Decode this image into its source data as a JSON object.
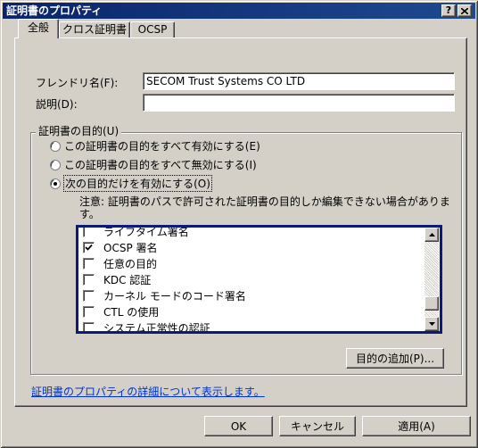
{
  "window": {
    "title": "証明書のプロパティ",
    "help_button": "?",
    "close_icon": "close-icon"
  },
  "tabs": [
    {
      "label": "全般",
      "selected": true
    },
    {
      "label": "クロス証明書",
      "selected": false
    },
    {
      "label": "OCSP",
      "selected": false
    }
  ],
  "general": {
    "friendly_name_label": "フレンドリ名(F):",
    "friendly_name_value": "SECOM Trust Systems CO LTD",
    "description_label": "説明(D):",
    "description_value": "",
    "purposes": {
      "group_label": "証明書の目的(U)",
      "options": [
        {
          "label": "この証明書の目的をすべて有効にする(E)",
          "selected": false
        },
        {
          "label": "この証明書の目的をすべて無効にする(I)",
          "selected": false
        },
        {
          "label": "次の目的だけを有効にする(O)",
          "selected": true
        }
      ],
      "note": "注意: 証明書のパスで許可された証明書の目的しか編集できない場合があります。",
      "list": [
        {
          "label": "ライフタイム署名",
          "checked": false
        },
        {
          "label": "OCSP 署名",
          "checked": true
        },
        {
          "label": "任意の目的",
          "checked": false
        },
        {
          "label": "KDC 認証",
          "checked": false
        },
        {
          "label": "カーネル モードのコード署名",
          "checked": false
        },
        {
          "label": "CTL の使用",
          "checked": false
        },
        {
          "label": "システム正常性の認証",
          "checked": false
        }
      ],
      "list_scroll_position": 0.9,
      "add_button": "目的の追加(P)..."
    },
    "help_link": "証明書のプロパティの詳細について表示します。"
  },
  "buttons": {
    "ok": "OK",
    "cancel": "キャンセル",
    "apply": "適用(A)"
  },
  "icons": {
    "scroll_up": "scroll-up-icon",
    "scroll_down": "scroll-down-icon",
    "checkmark": "checkmark-icon",
    "radio": "radio-icon"
  }
}
